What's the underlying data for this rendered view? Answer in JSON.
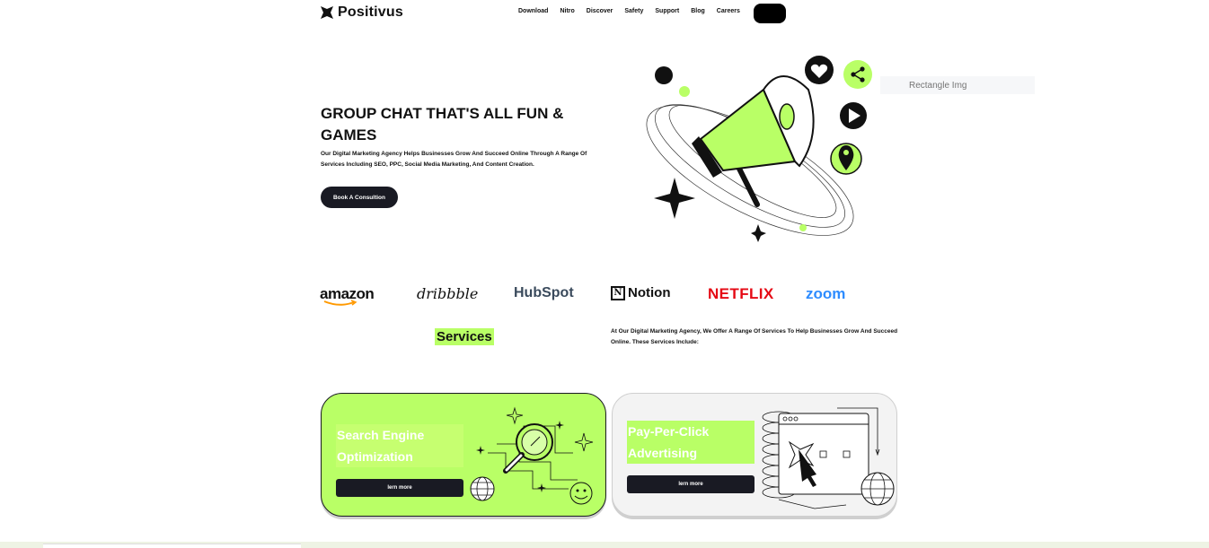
{
  "header": {
    "brand": "Positivus",
    "nav": [
      "Download",
      "Nitro",
      "Discover",
      "Safety",
      "Support",
      "Blog",
      "Careers"
    ],
    "cta_label": ""
  },
  "hero": {
    "title": "GROUP CHAT THAT'S ALL FUN & GAMES",
    "description": "Our Digital Marketing Agency Helps Businesses Grow And Succeed Online Through A Range Of Services Including SEO, PPC, Social Media Marketing, And Content Creation.",
    "button": "Book A Consultion",
    "ghost_placeholder": "Rectangle Img"
  },
  "logos": {
    "amazon": "amazon",
    "dribbble": "dribbble",
    "hubspot": "HubSpot",
    "notion": "Notion",
    "notion_mark": "N",
    "netflix": "NETFLIX",
    "zoom": "zoom"
  },
  "services": {
    "label": "Services",
    "description": "At Our Digital Marketing Agency, We Offer A Range Of Services To Help Businesses Grow And Succeed Online. These Services Include:",
    "cards": [
      {
        "title": "Search Engine Optimization",
        "button": "lern more"
      },
      {
        "title": "Pay-Per-Click Advertising",
        "button": "lern more"
      }
    ]
  },
  "colors": {
    "accent": "#b9ff66",
    "dark": "#191a23",
    "netflix": "#e50914",
    "zoom": "#2d8cff"
  }
}
